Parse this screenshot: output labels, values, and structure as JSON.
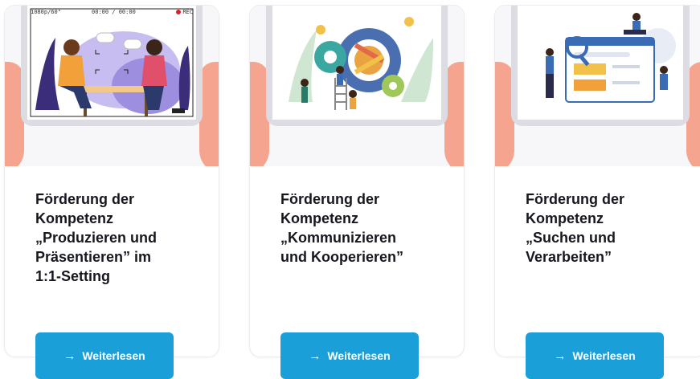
{
  "cards": [
    {
      "title": "Förderung der\nKompetenz\n„Produzieren und\nPräsentieren” im\n1:1-Setting",
      "illustration": "video-interview-illustration",
      "recording": {
        "resolution": "1080p/60\"",
        "time": "00:00 / 00:00",
        "rec_label": "REC"
      },
      "button": {
        "icon": "→",
        "label": "Weiterlesen"
      }
    },
    {
      "title": "Förderung der\nKompetenz\n„Kommunizieren\nund Kooperieren”",
      "illustration": "teamwork-gears-illustration",
      "button": {
        "icon": "→",
        "label": "Weiterlesen"
      }
    },
    {
      "title": "Förderung der\nKompetenz\n„Suchen und\nVerarbeiten”",
      "illustration": "web-search-illustration",
      "button": {
        "icon": "→",
        "label": "Weiterlesen"
      }
    }
  ],
  "colors": {
    "button": "#1b9fd8",
    "title": "#17171f",
    "hand": "#f4a48f"
  }
}
